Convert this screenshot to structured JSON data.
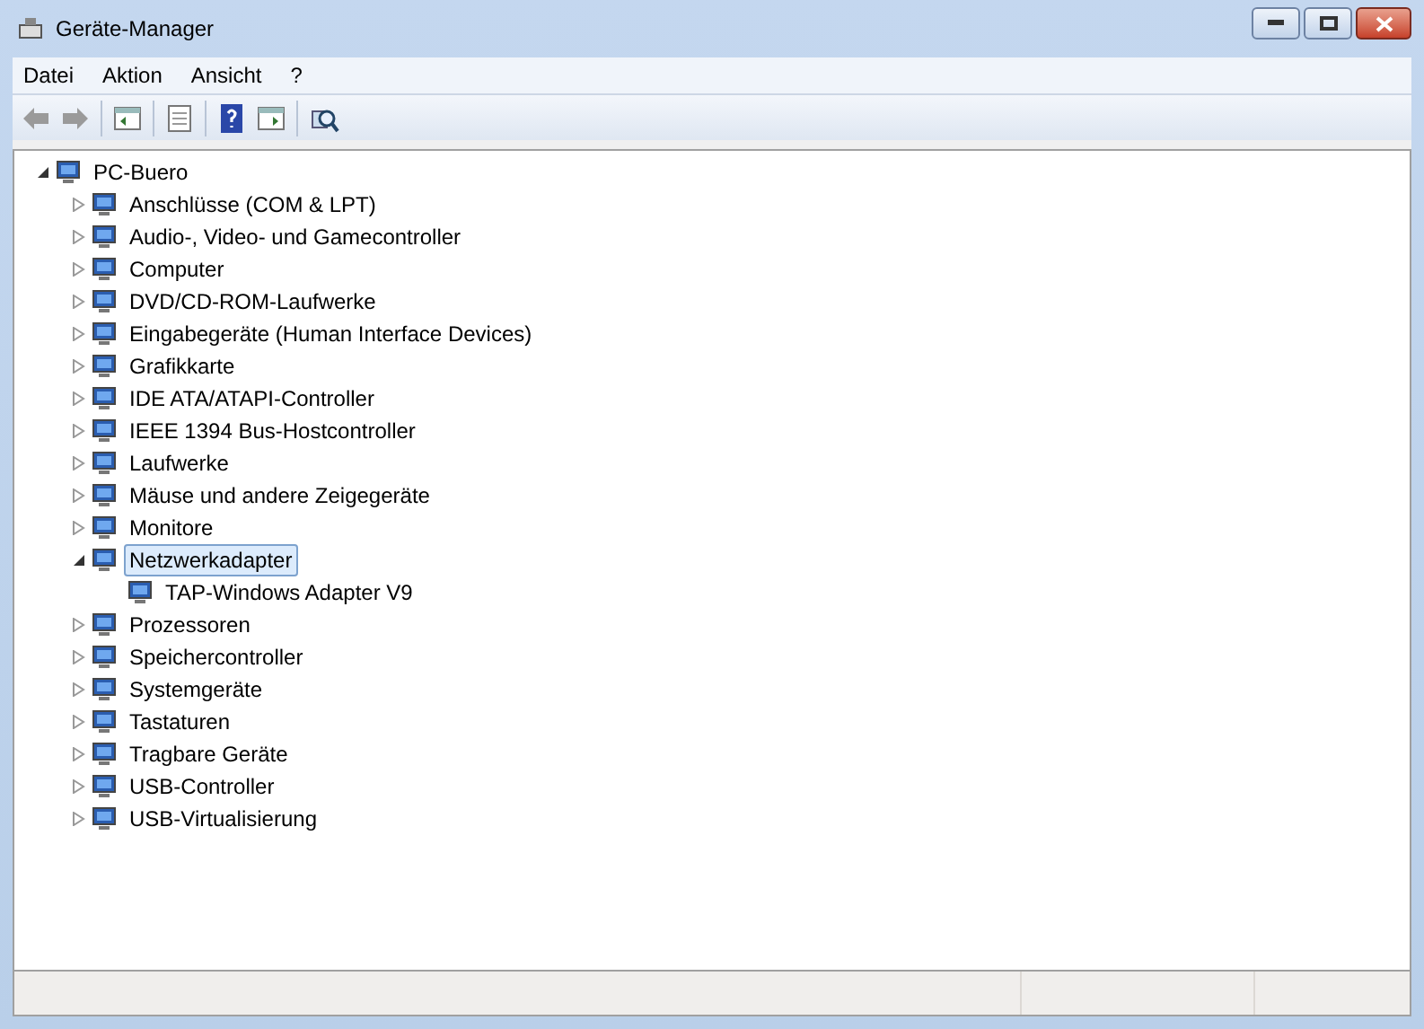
{
  "window": {
    "title": "Geräte-Manager"
  },
  "menu": [
    {
      "label": "Datei"
    },
    {
      "label": "Aktion"
    },
    {
      "label": "Ansicht"
    },
    {
      "label": "?"
    }
  ],
  "tree": {
    "label": "PC-Buero",
    "expanded": true,
    "selected": false,
    "children": [
      {
        "label": "Anschlüsse (COM & LPT)",
        "expanded": false,
        "selected": false
      },
      {
        "label": "Audio-, Video- und Gamecontroller",
        "expanded": false,
        "selected": false
      },
      {
        "label": "Computer",
        "expanded": false,
        "selected": false
      },
      {
        "label": "DVD/CD-ROM-Laufwerke",
        "expanded": false,
        "selected": false
      },
      {
        "label": "Eingabegeräte (Human Interface Devices)",
        "expanded": false,
        "selected": false
      },
      {
        "label": "Grafikkarte",
        "expanded": false,
        "selected": false
      },
      {
        "label": "IDE ATA/ATAPI-Controller",
        "expanded": false,
        "selected": false
      },
      {
        "label": "IEEE 1394 Bus-Hostcontroller",
        "expanded": false,
        "selected": false
      },
      {
        "label": "Laufwerke",
        "expanded": false,
        "selected": false
      },
      {
        "label": "Mäuse und andere Zeigegeräte",
        "expanded": false,
        "selected": false
      },
      {
        "label": "Monitore",
        "expanded": false,
        "selected": false
      },
      {
        "label": "Netzwerkadapter",
        "expanded": true,
        "selected": true,
        "children": [
          {
            "label": "TAP-Windows Adapter V9",
            "selected": false
          }
        ]
      },
      {
        "label": "Prozessoren",
        "expanded": false,
        "selected": false
      },
      {
        "label": "Speichercontroller",
        "expanded": false,
        "selected": false
      },
      {
        "label": "Systemgeräte",
        "expanded": false,
        "selected": false
      },
      {
        "label": "Tastaturen",
        "expanded": false,
        "selected": false
      },
      {
        "label": "Tragbare Geräte",
        "expanded": false,
        "selected": false
      },
      {
        "label": "USB-Controller",
        "expanded": false,
        "selected": false
      },
      {
        "label": "USB-Virtualisierung",
        "expanded": false,
        "selected": false
      }
    ]
  }
}
